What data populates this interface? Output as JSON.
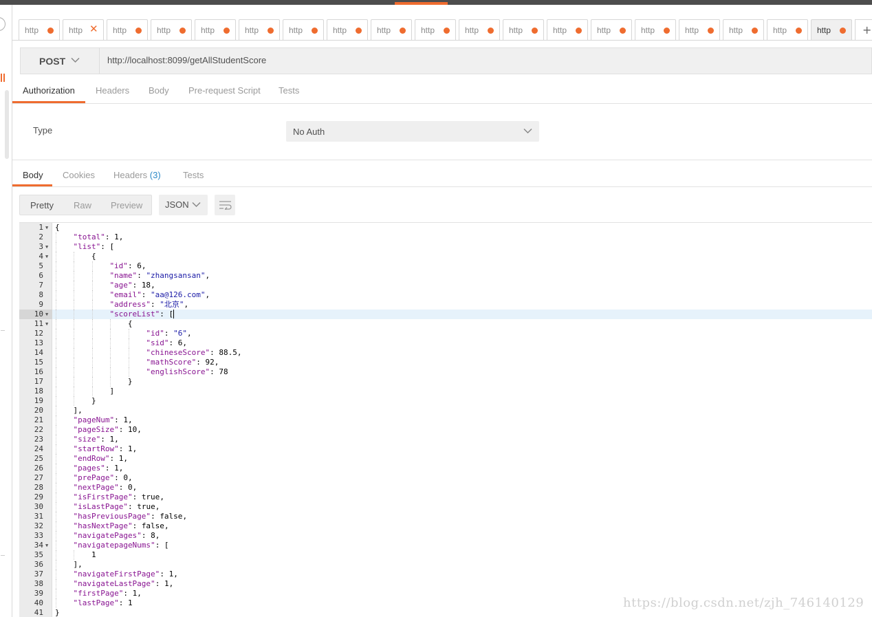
{
  "tabs": [
    {
      "label": "http",
      "indicator": "dot"
    },
    {
      "label": "http",
      "indicator": "close"
    },
    {
      "label": "http",
      "indicator": "dot"
    },
    {
      "label": "http",
      "indicator": "dot"
    },
    {
      "label": "http",
      "indicator": "dot"
    },
    {
      "label": "http",
      "indicator": "dot"
    },
    {
      "label": "http",
      "indicator": "dot"
    },
    {
      "label": "http",
      "indicator": "dot"
    },
    {
      "label": "http",
      "indicator": "dot"
    },
    {
      "label": "http",
      "indicator": "dot"
    },
    {
      "label": "http",
      "indicator": "dot"
    },
    {
      "label": "http",
      "indicator": "dot"
    },
    {
      "label": "http",
      "indicator": "dot"
    },
    {
      "label": "http",
      "indicator": "dot"
    },
    {
      "label": "http",
      "indicator": "dot"
    },
    {
      "label": "http",
      "indicator": "dot"
    },
    {
      "label": "http",
      "indicator": "dot"
    },
    {
      "label": "http",
      "indicator": "dot"
    },
    {
      "label": "http",
      "indicator": "dot",
      "active": true
    }
  ],
  "new_tab_label": "+",
  "request": {
    "method": "POST",
    "url": "http://localhost:8099/getAllStudentScore"
  },
  "request_tabs": [
    "Authorization",
    "Headers",
    "Body",
    "Pre-request Script",
    "Tests"
  ],
  "auth": {
    "type_label": "Type",
    "value": "No Auth"
  },
  "response_tabs": {
    "body": "Body",
    "cookies": "Cookies",
    "headers": "Headers",
    "headers_count": "(3)",
    "tests": "Tests"
  },
  "view_modes": [
    "Pretty",
    "Raw",
    "Preview"
  ],
  "format": "JSON",
  "highlighted_line": 10,
  "code_lines": [
    {
      "n": "1",
      "fold": true,
      "indent": 0,
      "t": [
        [
          "p",
          "{"
        ]
      ]
    },
    {
      "n": "2",
      "indent": 1,
      "t": [
        [
          "k",
          "\"total\""
        ],
        [
          "p",
          ": "
        ],
        [
          "n",
          "1"
        ],
        [
          "p",
          ","
        ]
      ]
    },
    {
      "n": "3",
      "fold": true,
      "indent": 1,
      "t": [
        [
          "k",
          "\"list\""
        ],
        [
          "p",
          ": ["
        ]
      ]
    },
    {
      "n": "4",
      "fold": true,
      "indent": 2,
      "t": [
        [
          "p",
          "{"
        ]
      ]
    },
    {
      "n": "5",
      "indent": 3,
      "t": [
        [
          "k",
          "\"id\""
        ],
        [
          "p",
          ": "
        ],
        [
          "n",
          "6"
        ],
        [
          "p",
          ","
        ]
      ]
    },
    {
      "n": "6",
      "indent": 3,
      "t": [
        [
          "k",
          "\"name\""
        ],
        [
          "p",
          ": "
        ],
        [
          "s",
          "\"zhangsansan\""
        ],
        [
          "p",
          ","
        ]
      ]
    },
    {
      "n": "7",
      "indent": 3,
      "t": [
        [
          "k",
          "\"age\""
        ],
        [
          "p",
          ": "
        ],
        [
          "n",
          "18"
        ],
        [
          "p",
          ","
        ]
      ]
    },
    {
      "n": "8",
      "indent": 3,
      "t": [
        [
          "k",
          "\"email\""
        ],
        [
          "p",
          ": "
        ],
        [
          "s",
          "\"aa@126.com\""
        ],
        [
          "p",
          ","
        ]
      ]
    },
    {
      "n": "9",
      "indent": 3,
      "t": [
        [
          "k",
          "\"address\""
        ],
        [
          "p",
          ": "
        ],
        [
          "s",
          "\"北京\""
        ],
        [
          "p",
          ","
        ]
      ]
    },
    {
      "n": "10",
      "fold": true,
      "indent": 3,
      "t": [
        [
          "k",
          "\"scoreList\""
        ],
        [
          "p",
          ": ["
        ]
      ]
    },
    {
      "n": "11",
      "fold": true,
      "indent": 4,
      "t": [
        [
          "p",
          "{"
        ]
      ]
    },
    {
      "n": "12",
      "indent": 5,
      "t": [
        [
          "k",
          "\"id\""
        ],
        [
          "p",
          ": "
        ],
        [
          "s",
          "\"6\""
        ],
        [
          "p",
          ","
        ]
      ]
    },
    {
      "n": "13",
      "indent": 5,
      "t": [
        [
          "k",
          "\"sid\""
        ],
        [
          "p",
          ": "
        ],
        [
          "n",
          "6"
        ],
        [
          "p",
          ","
        ]
      ]
    },
    {
      "n": "14",
      "indent": 5,
      "t": [
        [
          "k",
          "\"chineseScore\""
        ],
        [
          "p",
          ": "
        ],
        [
          "n",
          "88.5"
        ],
        [
          "p",
          ","
        ]
      ]
    },
    {
      "n": "15",
      "indent": 5,
      "t": [
        [
          "k",
          "\"mathScore\""
        ],
        [
          "p",
          ": "
        ],
        [
          "n",
          "92"
        ],
        [
          "p",
          ","
        ]
      ]
    },
    {
      "n": "16",
      "indent": 5,
      "t": [
        [
          "k",
          "\"englishScore\""
        ],
        [
          "p",
          ": "
        ],
        [
          "n",
          "78"
        ]
      ]
    },
    {
      "n": "17",
      "indent": 4,
      "t": [
        [
          "p",
          "}"
        ]
      ]
    },
    {
      "n": "18",
      "indent": 3,
      "t": [
        [
          "p",
          "]"
        ]
      ]
    },
    {
      "n": "19",
      "indent": 2,
      "t": [
        [
          "p",
          "}"
        ]
      ]
    },
    {
      "n": "20",
      "indent": 1,
      "t": [
        [
          "p",
          "],"
        ]
      ]
    },
    {
      "n": "21",
      "indent": 1,
      "t": [
        [
          "k",
          "\"pageNum\""
        ],
        [
          "p",
          ": "
        ],
        [
          "n",
          "1"
        ],
        [
          "p",
          ","
        ]
      ]
    },
    {
      "n": "22",
      "indent": 1,
      "t": [
        [
          "k",
          "\"pageSize\""
        ],
        [
          "p",
          ": "
        ],
        [
          "n",
          "10"
        ],
        [
          "p",
          ","
        ]
      ]
    },
    {
      "n": "23",
      "indent": 1,
      "t": [
        [
          "k",
          "\"size\""
        ],
        [
          "p",
          ": "
        ],
        [
          "n",
          "1"
        ],
        [
          "p",
          ","
        ]
      ]
    },
    {
      "n": "24",
      "indent": 1,
      "t": [
        [
          "k",
          "\"startRow\""
        ],
        [
          "p",
          ": "
        ],
        [
          "n",
          "1"
        ],
        [
          "p",
          ","
        ]
      ]
    },
    {
      "n": "25",
      "indent": 1,
      "t": [
        [
          "k",
          "\"endRow\""
        ],
        [
          "p",
          ": "
        ],
        [
          "n",
          "1"
        ],
        [
          "p",
          ","
        ]
      ]
    },
    {
      "n": "26",
      "indent": 1,
      "t": [
        [
          "k",
          "\"pages\""
        ],
        [
          "p",
          ": "
        ],
        [
          "n",
          "1"
        ],
        [
          "p",
          ","
        ]
      ]
    },
    {
      "n": "27",
      "indent": 1,
      "t": [
        [
          "k",
          "\"prePage\""
        ],
        [
          "p",
          ": "
        ],
        [
          "n",
          "0"
        ],
        [
          "p",
          ","
        ]
      ]
    },
    {
      "n": "28",
      "indent": 1,
      "t": [
        [
          "k",
          "\"nextPage\""
        ],
        [
          "p",
          ": "
        ],
        [
          "n",
          "0"
        ],
        [
          "p",
          ","
        ]
      ]
    },
    {
      "n": "29",
      "indent": 1,
      "t": [
        [
          "k",
          "\"isFirstPage\""
        ],
        [
          "p",
          ": "
        ],
        [
          "n",
          "true"
        ],
        [
          "p",
          ","
        ]
      ]
    },
    {
      "n": "30",
      "indent": 1,
      "t": [
        [
          "k",
          "\"isLastPage\""
        ],
        [
          "p",
          ": "
        ],
        [
          "n",
          "true"
        ],
        [
          "p",
          ","
        ]
      ]
    },
    {
      "n": "31",
      "indent": 1,
      "t": [
        [
          "k",
          "\"hasPreviousPage\""
        ],
        [
          "p",
          ": "
        ],
        [
          "n",
          "false"
        ],
        [
          "p",
          ","
        ]
      ]
    },
    {
      "n": "32",
      "indent": 1,
      "t": [
        [
          "k",
          "\"hasNextPage\""
        ],
        [
          "p",
          ": "
        ],
        [
          "n",
          "false"
        ],
        [
          "p",
          ","
        ]
      ]
    },
    {
      "n": "33",
      "indent": 1,
      "t": [
        [
          "k",
          "\"navigatePages\""
        ],
        [
          "p",
          ": "
        ],
        [
          "n",
          "8"
        ],
        [
          "p",
          ","
        ]
      ]
    },
    {
      "n": "34",
      "fold": true,
      "indent": 1,
      "t": [
        [
          "k",
          "\"navigatepageNums\""
        ],
        [
          "p",
          ": ["
        ]
      ]
    },
    {
      "n": "35",
      "indent": 2,
      "t": [
        [
          "n",
          "1"
        ]
      ]
    },
    {
      "n": "36",
      "indent": 1,
      "t": [
        [
          "p",
          "],"
        ]
      ]
    },
    {
      "n": "37",
      "indent": 1,
      "t": [
        [
          "k",
          "\"navigateFirstPage\""
        ],
        [
          "p",
          ": "
        ],
        [
          "n",
          "1"
        ],
        [
          "p",
          ","
        ]
      ]
    },
    {
      "n": "38",
      "indent": 1,
      "t": [
        [
          "k",
          "\"navigateLastPage\""
        ],
        [
          "p",
          ": "
        ],
        [
          "n",
          "1"
        ],
        [
          "p",
          ","
        ]
      ]
    },
    {
      "n": "39",
      "indent": 1,
      "t": [
        [
          "k",
          "\"firstPage\""
        ],
        [
          "p",
          ": "
        ],
        [
          "n",
          "1"
        ],
        [
          "p",
          ","
        ]
      ]
    },
    {
      "n": "40",
      "indent": 1,
      "t": [
        [
          "k",
          "\"lastPage\""
        ],
        [
          "p",
          ": "
        ],
        [
          "n",
          "1"
        ]
      ]
    },
    {
      "n": "41",
      "indent": 0,
      "t": [
        [
          "p",
          "}"
        ]
      ]
    }
  ],
  "watermark": "https://blog.csdn.net/zjh_746140129",
  "colors": {
    "accent": "#ef6c2f",
    "key": "#881391",
    "string": "#1a1aa6",
    "link": "#2d8ac7"
  }
}
